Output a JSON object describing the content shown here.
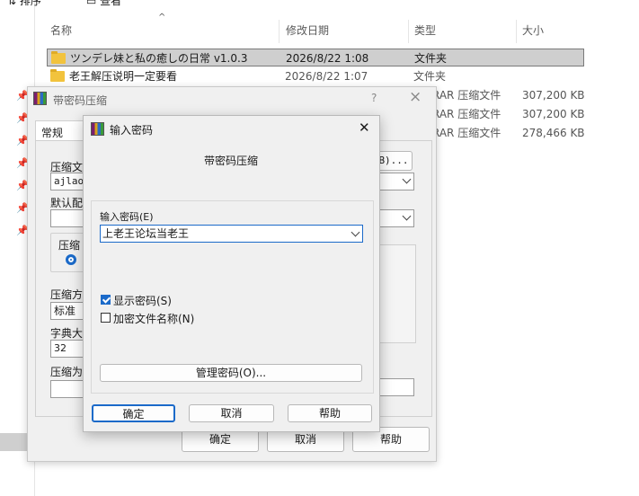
{
  "explorer": {
    "toolbar_partial": [
      "排序",
      "查看"
    ],
    "columns": [
      "名称",
      "修改日期",
      "类型",
      "大小"
    ],
    "rows": [
      {
        "name": "ツンデレ妹と私の癒しの日常 v1.0.3",
        "date": "2026/8/22 1:08",
        "type": "文件夹",
        "size": "",
        "selected": true
      },
      {
        "name": "老王解压说明一定要看",
        "date": "2026/8/22 1:07",
        "type": "文件夹",
        "size": "",
        "selected": false
      },
      {
        "name": "",
        "date": "",
        "type": "RAR 压缩文件",
        "size": "307,200 KB",
        "selected": false
      },
      {
        "name": "",
        "date": "",
        "type": "RAR 压缩文件",
        "size": "307,200 KB",
        "selected": false
      },
      {
        "name": "",
        "date": "",
        "type": "RAR 压缩文件",
        "size": "278,466 KB",
        "selected": false
      }
    ]
  },
  "back_dialog": {
    "title": "带密码压缩",
    "help_glyph": "?",
    "close_glyph": "×",
    "tab": "常规",
    "archive_label": "压缩文",
    "archive_value": "ajlaov",
    "browse_suffix": "B)...",
    "default_label": "默认配",
    "format_label": "压缩",
    "method_label": "压缩方",
    "method_value": "标准",
    "dict_label": "字典大",
    "dict_value": "32",
    "split_label": "压缩为",
    "ok": "确定",
    "cancel": "取消",
    "help": "帮助"
  },
  "front_dialog": {
    "title": "输入密码",
    "close_glyph": "✕",
    "heading": "带密码压缩",
    "password_label": "输入密码(E)",
    "password_value": "上老王论坛当老王",
    "show_password": {
      "label": "显示密码(S)",
      "checked": true
    },
    "encrypt_names": {
      "label": "加密文件名称(N)",
      "checked": false
    },
    "manage": "管理密码(O)...",
    "ok": "确定",
    "cancel": "取消",
    "help": "帮助"
  }
}
